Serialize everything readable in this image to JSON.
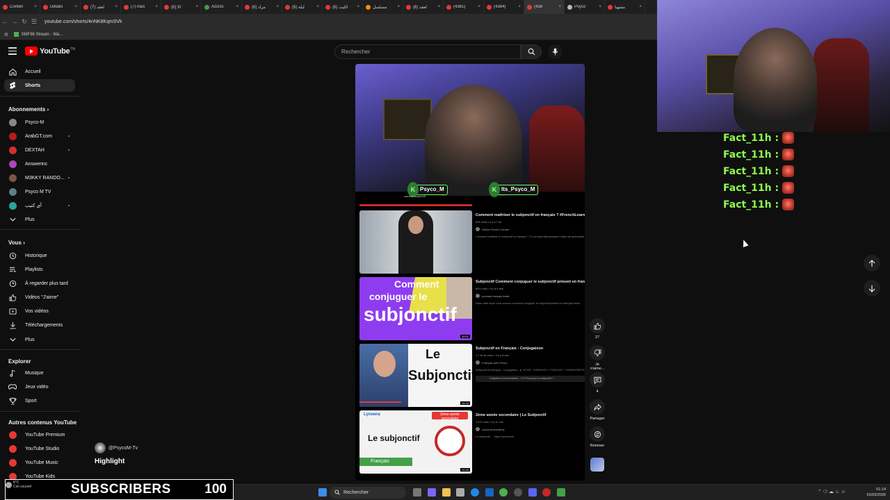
{
  "browser": {
    "tabs": [
      {
        "label": "Conten",
        "color": "#e53935"
      },
      {
        "label": "Détails",
        "color": "#e53935"
      },
      {
        "label": "(7) لعقد",
        "color": "#e53935"
      },
      {
        "label": "(7) Alas",
        "color": "#e53935"
      },
      {
        "label": "(6) الأ",
        "color": "#e53935"
      },
      {
        "label": "Azizos",
        "color": "#43a047"
      },
      {
        "label": "(6) مراد",
        "color": "#e53935"
      },
      {
        "label": "(6) ليلة",
        "color": "#e53935"
      },
      {
        "label": "(6) الليت",
        "color": "#e53935"
      },
      {
        "label": "مسلسل",
        "color": "#fb8c00"
      },
      {
        "label": "(6) لعقد",
        "color": "#e53935"
      },
      {
        "label": "(4381)",
        "color": "#e53935"
      },
      {
        "label": "(4384)",
        "color": "#e53935"
      },
      {
        "label": "(438",
        "color": "#e53935"
      },
      {
        "label": "Psyco",
        "color": "#bbbbbb"
      },
      {
        "label": "مشهيا",
        "color": "#e53935"
      }
    ],
    "url": "youtube.com/shorts/4nNK8KqmSVk",
    "bookmark": "SMF86 Stream - Wa..."
  },
  "youtube": {
    "logo_text": "YouTube",
    "logo_country": "TN",
    "search_placeholder": "Rechercher",
    "sidebar": {
      "main": [
        {
          "label": "Accueil",
          "icon": "home-icon"
        },
        {
          "label": "Shorts",
          "icon": "shorts-icon",
          "selected": true
        }
      ],
      "subs_header": "Abonnements",
      "subscriptions": [
        {
          "label": "Psyco-M",
          "color": "#888888",
          "dot": false
        },
        {
          "label": "ArabGT.com",
          "color": "#b71c1c",
          "dot": true
        },
        {
          "label": "DEXTAH",
          "color": "#d32f2f",
          "dot": true
        },
        {
          "label": "Answerinc",
          "color": "#ab47bc",
          "dot": false
        },
        {
          "label": "M3KKY RANDO...",
          "color": "#795548",
          "dot": true
        },
        {
          "label": "Psyco M TV",
          "color": "#607d8b",
          "dot": false
        },
        {
          "label": "آي كتيب",
          "color": "#26a69a",
          "dot": true
        }
      ],
      "subs_more": "Plus",
      "you_header": "Vous",
      "you": [
        {
          "label": "Historique",
          "icon": "history-icon"
        },
        {
          "label": "Playlists",
          "icon": "playlist-icon"
        },
        {
          "label": "À regarder plus tard",
          "icon": "clock-icon"
        },
        {
          "label": "Vidéos \"J'aime\"",
          "icon": "thumbs-up-icon"
        },
        {
          "label": "Vos vidéos",
          "icon": "video-icon"
        },
        {
          "label": "Téléchargements",
          "icon": "download-icon"
        }
      ],
      "you_more": "Plus",
      "explore_header": "Explorer",
      "explore": [
        {
          "label": "Musique",
          "icon": "music-icon"
        },
        {
          "label": "Jeux vidéo",
          "icon": "gamepad-icon"
        },
        {
          "label": "Sport",
          "icon": "trophy-icon"
        }
      ],
      "other_header": "Autres contenus YouTube",
      "other": [
        {
          "label": "YouTube Premium"
        },
        {
          "label": "YouTube Studio"
        },
        {
          "label": "YouTube Music"
        },
        {
          "label": "YouTube Kids"
        }
      ]
    },
    "player": {
      "badges": [
        "Psyco_M",
        "Its_Psyco_M"
      ],
      "badge_sub": "camera subjonctif",
      "recommendations": [
        {
          "title": "Comment maîtriser le subjonctif en français ? #FrenchLearner",
          "stats": "62K vues • Il y a 1 an",
          "channel": "Online French Course",
          "desc": "Comment maîtriser le subjonctif en français ? Tu connais déjà quelques règles de grammaire",
          "duration": "",
          "thumb": "woman"
        },
        {
          "title": "Subjonctif Comment conjuguer le subjonctif présent en français",
          "stats": "80 k vues • Il y a 4 ans",
          "channel": "podcast français facile",
          "desc": "Dans cette leçon nous verrons comment conjuguer le subjonctif présent en français facile.",
          "duration": "10:01",
          "thumb": "comment"
        },
        {
          "title": "Subjonctif en Français : Conjugaison",
          "stats": "1,7 M de vues • Il y a 8 ans",
          "channel": "Français avec Pierre",
          "desc": "Subjonctif en français - Conjugaison. ▲ FICHE + EXERCICE + PODCAST + TRANSCRIPTION",
          "duration": "16:33",
          "thumb": "le"
        },
        {
          "title": "2ème année secondaire | Le Subjonctif",
          "stats": "1,6 K vues • Il y a 1 an",
          "channel": "Lyceena Academy",
          "desc": "Le subjonctif ... https://lyceena.tn",
          "duration": "10:33",
          "thumb": "lyceena"
        }
      ],
      "thumb_text": {
        "comment1": "Comment",
        "comment2": "conjuguer le",
        "comment3": "subjonctif",
        "le1": "Le",
        "le2": "Subjonctif",
        "ly_brand": "Lyceena",
        "ly_tag": "2ème année secondaire",
        "ly_title": "Le subjonctif",
        "ly_sub": "Français"
      },
      "chapters_label": "Chapitres commentaires : 2:12 Pourquoi le subjonctif ?"
    },
    "actions": [
      {
        "icon": "thumbs-up-icon",
        "label": "27"
      },
      {
        "icon": "thumbs-down-icon",
        "label": "Je n'aime..."
      },
      {
        "icon": "comment-icon",
        "label": "4"
      },
      {
        "icon": "share-icon",
        "label": "Partager"
      },
      {
        "icon": "remix-icon",
        "label": "Remixer"
      }
    ]
  },
  "overlay": {
    "chat": [
      {
        "text": "Fact_11h :"
      },
      {
        "text": "Fact_11h :"
      },
      {
        "text": "Fact_11h :"
      },
      {
        "text": "Fact_11h :"
      },
      {
        "text": "Fact_11h :"
      }
    ],
    "handle": "@PsycoM-Tv",
    "highlight": "Highlight",
    "subscribers_label": "SUBSCRIBERS",
    "subscribers_value": "100"
  },
  "taskbar": {
    "weather_temp": "8°C",
    "weather_desc": "Ciel couvert",
    "search": "Rechercher",
    "time": "01:14",
    "date": "01/03/2026"
  }
}
